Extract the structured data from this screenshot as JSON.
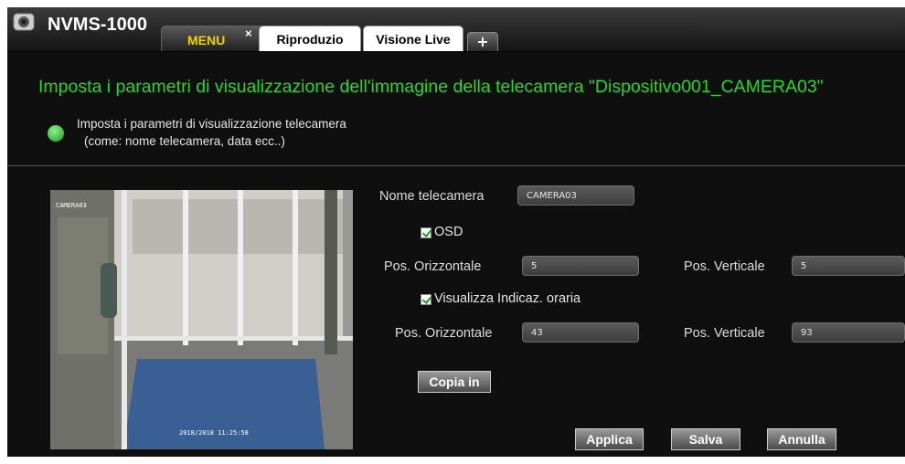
{
  "app": {
    "title": "NVMS-1000",
    "icon": "camera-logo-icon"
  },
  "tabs": [
    {
      "label": "MENU",
      "active": true,
      "close": "×"
    },
    {
      "label": "Riproduzio"
    },
    {
      "label": "Visione Live"
    }
  ],
  "add_tab_label": "+",
  "page": {
    "heading": "Imposta i parametri di visualizzazione dell'immagine della telecamera \"Dispositivo001_CAMERA03\"",
    "info_line1": "Imposta i parametri di visualizzazione telecamera",
    "info_line2": "(come: nome telecamera, data ecc..)"
  },
  "preview": {
    "osd_name": "CAMERA03",
    "osd_time": "2018/2018 11:25:58"
  },
  "form": {
    "camera_name_label": "Nome telecamera",
    "camera_name_value": "CAMERA03",
    "osd_label": "OSD",
    "osd_checked": true,
    "name_pos_h_label": "Pos. Orizzontale",
    "name_pos_h_value": "5",
    "name_pos_v_label": "Pos. Verticale",
    "name_pos_v_value": "5",
    "time_label": "Visualizza Indicaz. oraria",
    "time_checked": true,
    "time_pos_h_label": "Pos. Orizzontale",
    "time_pos_h_value": "43",
    "time_pos_v_label": "Pos. Verticale",
    "time_pos_v_value": "93"
  },
  "buttons": {
    "copy": "Copia in",
    "apply": "Applica",
    "save": "Salva",
    "cancel": "Annulla"
  },
  "colors": {
    "accent_green": "#2bd52b",
    "menu_tab_text": "#f0d000",
    "background": "#0f0f0f"
  }
}
